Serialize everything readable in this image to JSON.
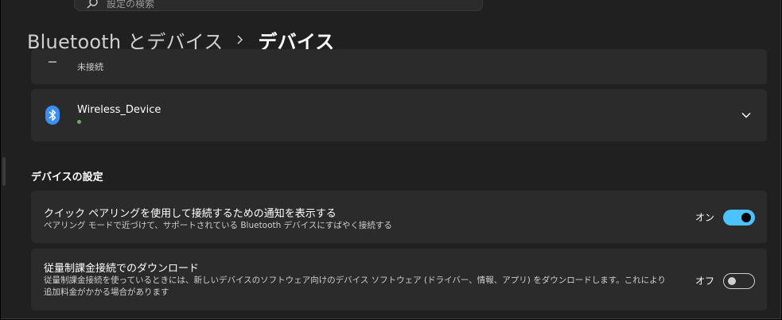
{
  "search": {
    "placeholder": "設定の検索"
  },
  "breadcrumb": {
    "parent": "Bluetooth とデバイス",
    "current": "デバイス"
  },
  "previous_device": {
    "status": "未接続"
  },
  "device": {
    "name": "Wireless_Device",
    "status_color": "#5fb84f"
  },
  "section": {
    "title": "デバイスの設定"
  },
  "settings": [
    {
      "title": "クイック ペアリングを使用して接続するための通知を表示する",
      "description": "ペアリング モードで近づけて、サポートされている Bluetooth デバイスにすばやく接続する",
      "toggle_label": "オン",
      "toggle_on": true
    },
    {
      "title": "従量制課金接続でのダウンロード",
      "description": "従量制課金接続を使っているときには、新しいデバイスのソフトウェア向けのデバイス ソフトウェア (ドライバー、情報、アプリ) をダウンロードします。これにより追加料金がかかる場合があります",
      "toggle_label": "オフ",
      "toggle_on": false
    }
  ],
  "colors": {
    "accent": "#4cc2ff",
    "background": "#202020",
    "card": "#2b2b2b"
  }
}
